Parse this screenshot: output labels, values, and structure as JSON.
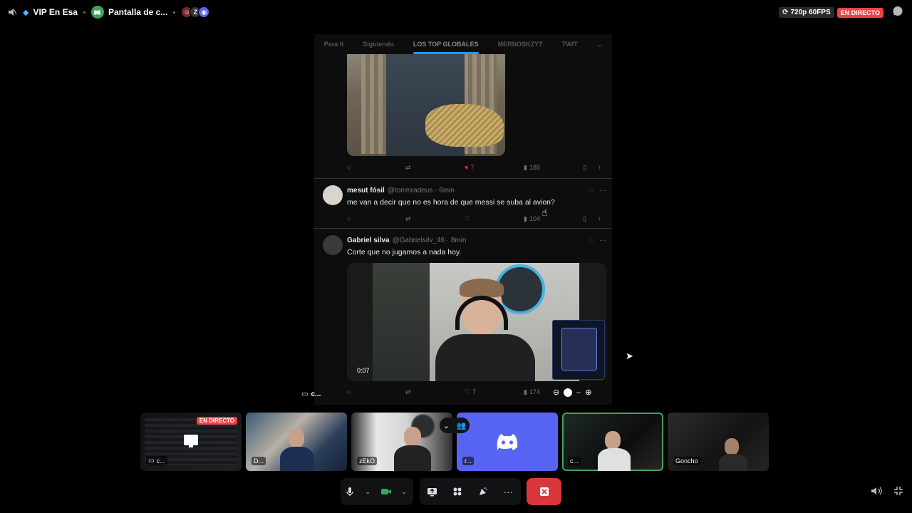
{
  "topbar": {
    "server_name": "VIP En Esa",
    "channel_name": "Pantalla de c...",
    "quality": "720p 60FPS",
    "live_label": "EN DIRECTO"
  },
  "stream": {
    "tabs": [
      "Para ti",
      "Siguiendo",
      "LOS TOP GLOBALES",
      "MERNOSKZYT",
      "TWIT",
      "..."
    ],
    "post1_actions": {
      "likes": "7",
      "views": "185"
    },
    "tweets": [
      {
        "name": "mesut fósil",
        "handle": "@torreiradeus · 6min",
        "text": "me van a decir que no es hora de que messi se suba al avion?",
        "views": "104"
      },
      {
        "name": "Gabriel silva",
        "handle": "@Gabrielsilv_46 · 8min",
        "text": "Corte que no jugamos a nada hoy.",
        "video_time": "0:07",
        "likes": "7",
        "views": "174"
      }
    ],
    "presenter_label": "c..."
  },
  "tiles": [
    {
      "name": "c...",
      "live": "EN DIRECTO"
    },
    {
      "name": "D..."
    },
    {
      "name": "zEkO"
    },
    {
      "name": "r..."
    },
    {
      "name": "c..."
    },
    {
      "name": "Goncho"
    }
  ],
  "colors": {
    "accent_green": "#3ba55c",
    "live_red": "#ed4245",
    "discord_blurple": "#5865f2",
    "end_call_red": "#da373c"
  }
}
